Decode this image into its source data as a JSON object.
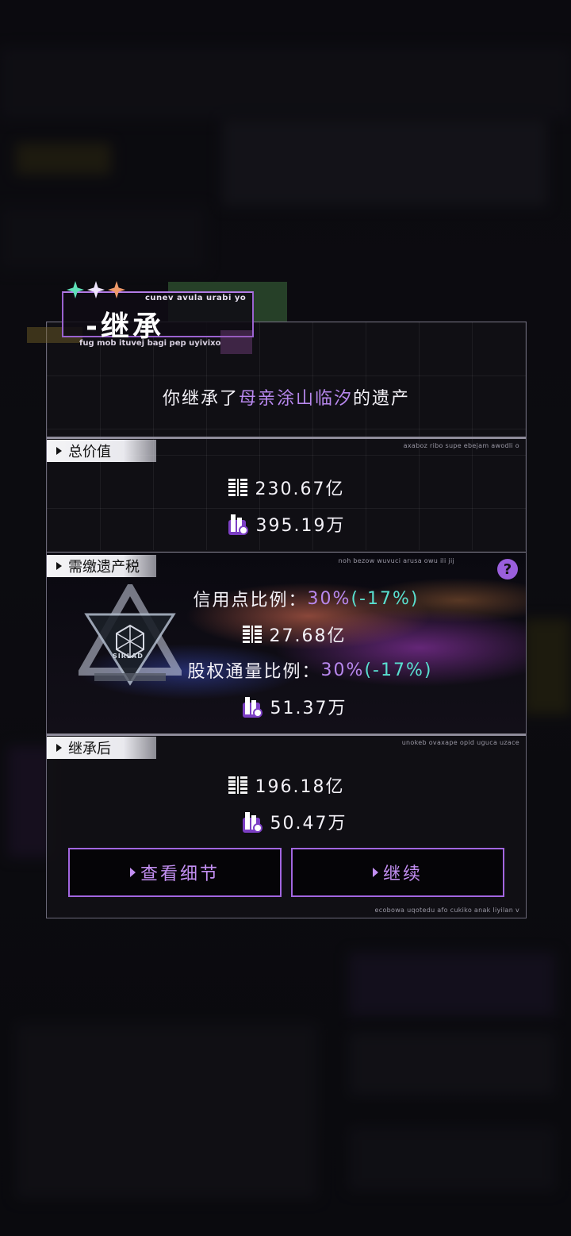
{
  "colors": {
    "accent": "#b888ee",
    "cyan": "#59e0d0",
    "panel_border": "#6b6878"
  },
  "title": {
    "main": "-继承",
    "sub": "cunev avula urabi yo",
    "under": "fug mob ituvej bagi pep uyivixo"
  },
  "intro": {
    "prefix": "你继承了",
    "highlight": "母亲涂山临汐",
    "suffix": "的遗产"
  },
  "total_value": {
    "label": "总价值",
    "note": "axaboz ribo supe ebejam awodli o",
    "coins": "230.67亿",
    "shares": "395.19万"
  },
  "tax": {
    "label": "需缴遗产税",
    "note": "noh bezow wuvuci arusa owu ili jij",
    "credit_ratio_label": "信用点比例：",
    "credit_ratio_value": "30%",
    "credit_ratio_change": "(-17%)",
    "coins": "27.68亿",
    "equity_ratio_label": "股权通量比例：",
    "equity_ratio_value": "30%",
    "equity_ratio_change": "(-17%)",
    "shares": "51.37万",
    "emblem_text": "SIRLAD"
  },
  "after": {
    "label": "继承后",
    "note": "unokeb ovaxape opid uguca uzace",
    "coins": "196.18亿",
    "shares": "50.47万"
  },
  "buttons": {
    "details": "查看细节",
    "continue": "继续"
  },
  "footer_note": "ecobowa uqotedu afo cukiko anak liyilan v",
  "icons": {
    "coin": "credit-coin-icon",
    "share": "equity-share-icon",
    "help": "help-icon"
  }
}
